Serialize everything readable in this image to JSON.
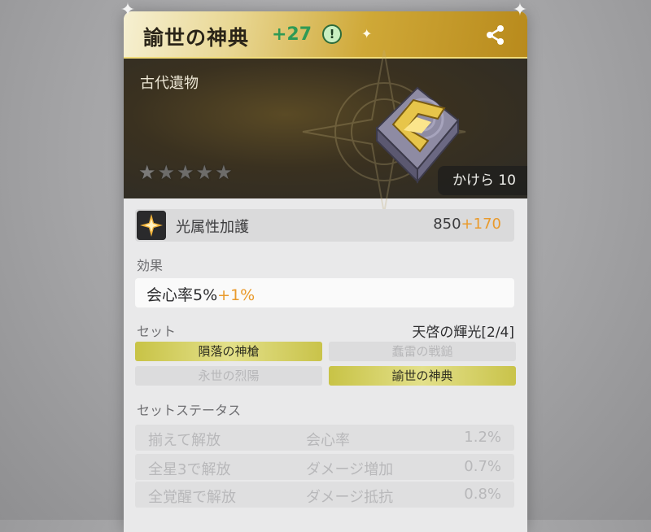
{
  "relic": {
    "name": "諭世の神典",
    "level": "+27",
    "info_glyph": "!",
    "category": "古代遺物",
    "fragments_label": "かけら 10",
    "star_count": 5
  },
  "main_stat": {
    "name": "光属性加護",
    "base": "850",
    "bonus": "+170"
  },
  "effect": {
    "section_label": "効果",
    "text": "会心率5%",
    "bonus": "+1%"
  },
  "set": {
    "section_label": "セット",
    "name": "天啓の輝光[2/4]",
    "pieces": [
      {
        "label": "隕落の神槍",
        "active": true
      },
      {
        "label": "蠢雷の戦鎚",
        "active": false
      },
      {
        "label": "永世の烈陽",
        "active": false
      },
      {
        "label": "諭世の神典",
        "active": true
      }
    ]
  },
  "set_status": {
    "section_label": "セットステータス",
    "rows": [
      {
        "condition": "揃えて解放",
        "stat": "会心率",
        "value": "1.2%"
      },
      {
        "condition": "全星3で解放",
        "stat": "ダメージ増加",
        "value": "0.7%"
      },
      {
        "condition": "全覚醒で解放",
        "stat": "ダメージ抵抗",
        "value": "0.8%"
      }
    ]
  },
  "colors": {
    "accent_gold": "#cfa837",
    "level_green": "#2f9a55",
    "bonus_orange": "#e99a2c",
    "set_active": "#d6d26a"
  },
  "icons": {
    "info": "info-icon",
    "share": "share-icon",
    "star": "star-icon",
    "element": "light-element-icon"
  }
}
